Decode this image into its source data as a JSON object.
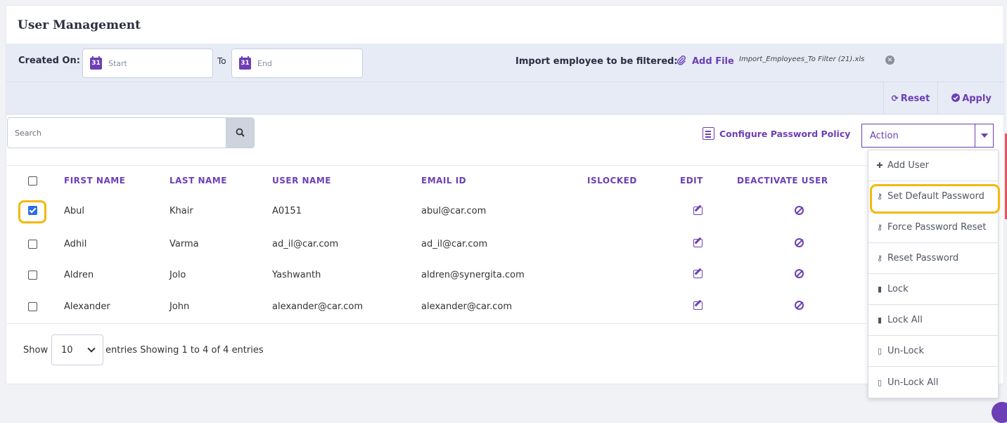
{
  "page": {
    "title": "User Management"
  },
  "filters": {
    "created_on_label": "Created On:",
    "start_placeholder": "Start",
    "to_label": "To",
    "end_placeholder": "End",
    "calendar_day": "31",
    "import_label": "Import employee to be filtered:",
    "add_file_label": "Add File",
    "file_name": "Import_Employees_To Filter (21).xls"
  },
  "toolbar": {
    "reset_label": "Reset",
    "apply_label": "Apply"
  },
  "search": {
    "placeholder": "Search"
  },
  "configure_label": "Configure Password Policy",
  "action": {
    "selected": "Action",
    "items": [
      {
        "label": "Add User",
        "icon": "plus-icon"
      },
      {
        "label": "Set Default Password",
        "icon": "key-icon",
        "highlighted": true
      },
      {
        "label": "Force Password Reset",
        "icon": "key-icon"
      },
      {
        "label": "Reset Password",
        "icon": "key-icon"
      },
      {
        "label": "Lock",
        "icon": "lock-icon"
      },
      {
        "label": "Lock All",
        "icon": "lock-icon"
      },
      {
        "label": "Un-Lock",
        "icon": "unlock-icon"
      },
      {
        "label": "Un-Lock All",
        "icon": "unlock-icon"
      }
    ]
  },
  "table": {
    "columns": [
      "FIRST NAME",
      "LAST NAME",
      "USER NAME",
      "EMAIL ID",
      "ISLOCKED",
      "EDIT",
      "DEACTIVATE USER"
    ],
    "rows": [
      {
        "checked": true,
        "first": "Abul",
        "last": "Khair",
        "user": "A0151",
        "email": "abul@car.com"
      },
      {
        "checked": false,
        "first": "Adhil",
        "last": "Varma",
        "user": "ad_il@car.com",
        "email": "ad_il@car.com"
      },
      {
        "checked": false,
        "first": "Aldren",
        "last": "Jolo",
        "user": "Yashwanth",
        "email": "aldren@synergita.com"
      },
      {
        "checked": false,
        "first": "Alexander",
        "last": "John",
        "user": "alexander@car.com",
        "email": "alexander@car.com"
      }
    ]
  },
  "footer": {
    "show_label": "Show",
    "page_size": "10",
    "entries_info": "entries Showing 1 to 4 of 4 entries"
  },
  "colors": {
    "accent": "#6c3fb5",
    "highlight": "#f2b90f",
    "filter_bg": "#e7ebf6"
  }
}
